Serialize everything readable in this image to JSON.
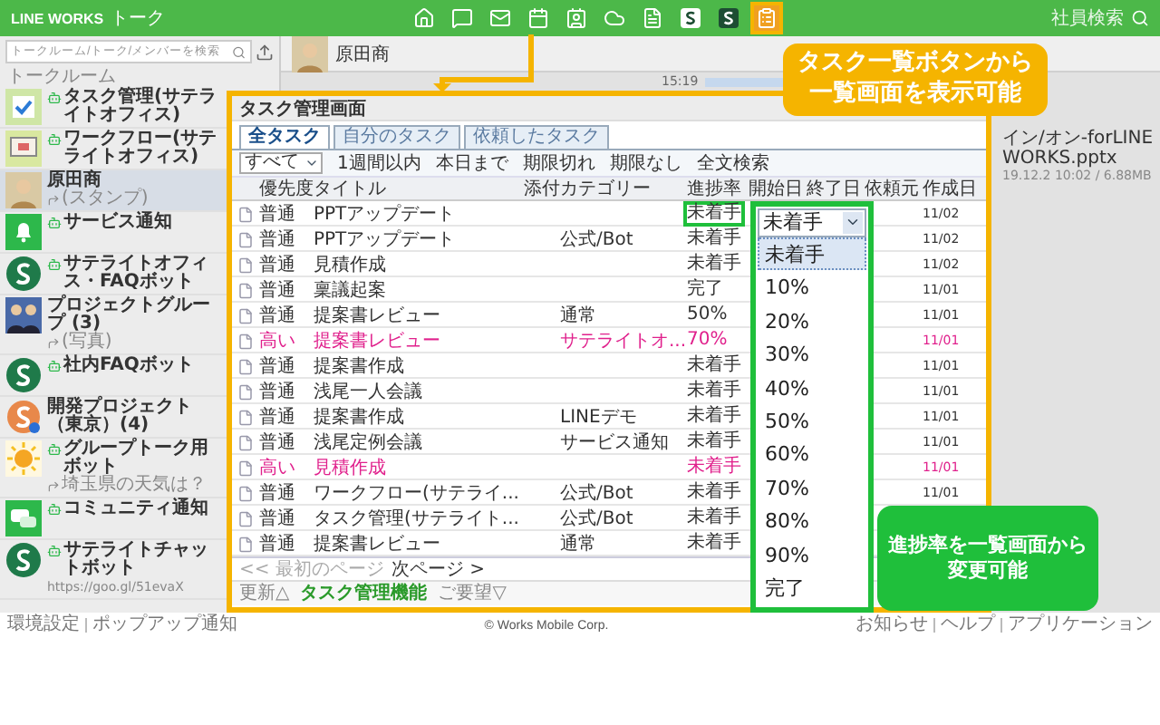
{
  "topbar": {
    "logo": "LINE WORKS",
    "app_name": "トーク",
    "employee_search": "社員検索",
    "nav_icons": [
      {
        "kind": "home",
        "highlighted": false
      },
      {
        "kind": "chat",
        "highlighted": false
      },
      {
        "kind": "mail",
        "highlighted": false
      },
      {
        "kind": "calendar",
        "highlighted": false
      },
      {
        "kind": "contacts",
        "highlighted": false
      },
      {
        "kind": "cloud",
        "highlighted": false
      },
      {
        "kind": "note",
        "highlighted": false
      },
      {
        "kind": "s-logo",
        "highlighted": false
      },
      {
        "kind": "s-logo-dark",
        "highlighted": false
      },
      {
        "kind": "task",
        "highlighted": true
      }
    ]
  },
  "sidebar": {
    "search": {
      "placeholder": "トークルーム/トーク/メンバーを検索"
    },
    "header": "トークルーム",
    "rooms": [
      {
        "name": "タスク管理(サテライトオフィス)",
        "kind": "task",
        "bot": true,
        "selected": false,
        "reply": false
      },
      {
        "name": "ワークフロー(サテライトオフィス)",
        "kind": "workflow",
        "bot": true,
        "selected": false,
        "reply": false
      },
      {
        "name": "原田商",
        "kind": "person",
        "bot": false,
        "selected": true,
        "reply": true,
        "preview": "(スタンプ)"
      },
      {
        "name": "サービス通知",
        "kind": "bell",
        "bot": true,
        "selected": false,
        "reply": false
      },
      {
        "name": "サテライトオフィス・FAQボット",
        "kind": "s-green",
        "bot": true,
        "selected": false,
        "reply": false
      },
      {
        "name": "プロジェクトグループ (3)",
        "kind": "group",
        "bot": false,
        "selected": false,
        "reply": true,
        "preview": "(写真)"
      },
      {
        "name": "社内FAQボット",
        "kind": "s-green",
        "bot": true,
        "selected": false,
        "reply": false
      },
      {
        "name": "開発プロジェクト（東京）(4)",
        "kind": "s-orange",
        "bot": false,
        "selected": false,
        "reply": false
      },
      {
        "name": "グループトーク用ボット",
        "kind": "sun",
        "bot": true,
        "selected": false,
        "reply": true,
        "preview": "埼玉県の天気は？"
      },
      {
        "name": "コミュニティ通知",
        "kind": "chat",
        "bot": true,
        "selected": false,
        "reply": false
      },
      {
        "name": "サテライトチャットボット",
        "kind": "s-green",
        "bot": true,
        "selected": false,
        "reply": false,
        "preview": "https://goo.gl/51evaX"
      }
    ]
  },
  "chat": {
    "room_name": "原田商",
    "time": "15:19",
    "file": {
      "name": "イン/オン-forLINE WORKS.pptx",
      "meta": "19.12.2 10:02 / 6.88MB"
    }
  },
  "task_window": {
    "title": "タスク管理画面",
    "tabs": [
      {
        "label": "全タスク",
        "selected": true
      },
      {
        "label": "自分のタスク",
        "selected": false
      },
      {
        "label": "依頼したタスク",
        "selected": false
      }
    ],
    "filter": {
      "select": "すべて",
      "links": [
        "1週間以内",
        "本日まで",
        "期限切れ",
        "期限なし",
        "全文検索"
      ]
    },
    "columns": [
      "優先度",
      "タイトル",
      "添付",
      "カテゴリー",
      "進捗率",
      "開始日",
      "終了日",
      "依頼元",
      "作成日"
    ],
    "rows": [
      {
        "priority": "普通",
        "high": false,
        "title": "PPTアップデート",
        "progress": "未着手",
        "progress_highlighted": true,
        "created": "11/02"
      },
      {
        "priority": "普通",
        "high": false,
        "title": "PPTアップデート",
        "category": "公式/Bot",
        "progress": "未着手",
        "progress_highlighted": false,
        "created": "11/02"
      },
      {
        "priority": "普通",
        "high": false,
        "title": "見積作成",
        "progress": "未着手",
        "progress_highlighted": false,
        "created": "11/02"
      },
      {
        "priority": "普通",
        "high": false,
        "title": "稟議起案",
        "progress": "完了",
        "progress_highlighted": false,
        "created": "11/01"
      },
      {
        "priority": "普通",
        "high": false,
        "title": "提案書レビュー",
        "category": "通常",
        "progress": "50%",
        "progress_highlighted": false,
        "created": "11/01"
      },
      {
        "priority": "高い",
        "high": true,
        "title": "提案書レビュー",
        "category": "サテライトオ...",
        "progress": "70%",
        "progress_highlighted": false,
        "created": "11/01"
      },
      {
        "priority": "普通",
        "high": false,
        "title": "提案書作成",
        "progress": "未着手",
        "progress_highlighted": false,
        "created": "11/01"
      },
      {
        "priority": "普通",
        "high": false,
        "title": "浅尾一人会議",
        "progress": "未着手",
        "progress_highlighted": false,
        "created": "11/01"
      },
      {
        "priority": "普通",
        "high": false,
        "title": "提案書作成",
        "category": "LINEデモ",
        "progress": "未着手",
        "progress_highlighted": false,
        "created": "11/01"
      },
      {
        "priority": "普通",
        "high": false,
        "title": "浅尾定例会議",
        "category": "サービス通知",
        "progress": "未着手",
        "progress_highlighted": false,
        "created": "11/01"
      },
      {
        "priority": "高い",
        "high": true,
        "title": "見積作成",
        "progress": "未着手",
        "progress_highlighted": false,
        "created": "11/01"
      },
      {
        "priority": "普通",
        "high": false,
        "title": "ワークフロー(サテライ...",
        "category": "公式/Bot",
        "progress": "未着手",
        "progress_highlighted": false,
        "created": "11/01"
      },
      {
        "priority": "普通",
        "high": false,
        "title": "タスク管理(サテライト...",
        "category": "公式/Bot",
        "progress": "未着手",
        "progress_highlighted": false
      },
      {
        "priority": "普通",
        "high": false,
        "title": "提案書レビュー",
        "category": "通常",
        "progress": "未着手",
        "progress_highlighted": false
      }
    ],
    "pager": {
      "first": "<< 最初のページ",
      "next": "次ページ >"
    },
    "footer": {
      "update": "更新△",
      "feature": "タスク管理機能",
      "request": "ご要望▽"
    }
  },
  "progress_dropdown": {
    "value": "未着手",
    "options": [
      {
        "label": "未着手",
        "selected": true
      },
      {
        "label": "10%",
        "selected": false
      },
      {
        "label": "20%",
        "selected": false
      },
      {
        "label": "30%",
        "selected": false
      },
      {
        "label": "40%",
        "selected": false
      },
      {
        "label": "50%",
        "selected": false
      },
      {
        "label": "60%",
        "selected": false
      },
      {
        "label": "70%",
        "selected": false
      },
      {
        "label": "80%",
        "selected": false
      },
      {
        "label": "90%",
        "selected": false
      },
      {
        "label": "完了",
        "selected": false
      }
    ]
  },
  "callouts": [
    {
      "kind": "orange",
      "text": "タスク一覧ボタンから一覧画面を表示可能"
    },
    {
      "kind": "green",
      "text": "進捗率を一覧画面から変更可能"
    }
  ],
  "footer": {
    "left": [
      "環境設定",
      "ポップアップ通知"
    ],
    "copyright": "© Works Mobile Corp.",
    "right": [
      "お知らせ",
      "ヘルプ",
      "アプリケーション"
    ]
  }
}
